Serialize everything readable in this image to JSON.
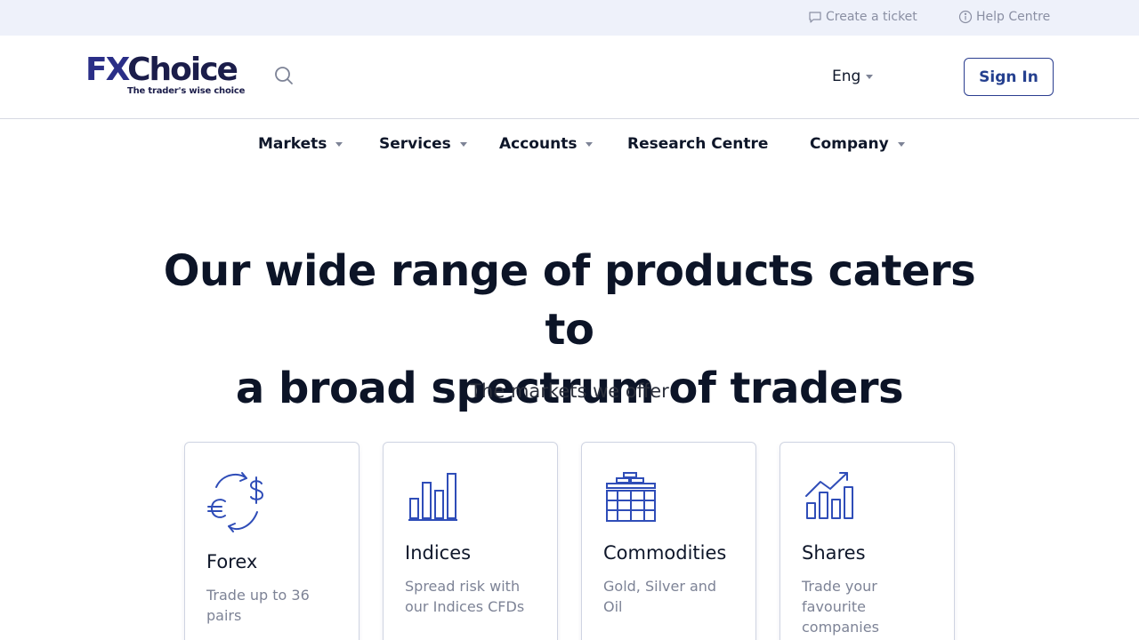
{
  "topbar": {
    "create_ticket": "Create a ticket",
    "help_centre": "Help Centre"
  },
  "header": {
    "logo_fx": "FX",
    "logo_choice": "Choice",
    "logo_tagline": "The trader's wise choice",
    "language": "Eng",
    "sign_in": "Sign In"
  },
  "nav": {
    "items": [
      {
        "label": "Markets",
        "dropdown": true
      },
      {
        "label": "Services",
        "dropdown": true
      },
      {
        "label": "Accounts",
        "dropdown": true
      },
      {
        "label": "Research Centre",
        "dropdown": false
      },
      {
        "label": "Company",
        "dropdown": true
      }
    ]
  },
  "hero": {
    "title_line1": "Our wide range of products caters to",
    "title_line2": "a broad spectrum of traders",
    "subtitle": "The markets we offer"
  },
  "cards": [
    {
      "title": "Forex",
      "desc": "Trade up to 36 pairs",
      "icon": "currency-exchange-icon"
    },
    {
      "title": "Indices",
      "desc": "Spread risk with our Indices CFDs",
      "icon": "bar-chart-icon"
    },
    {
      "title": "Commodities",
      "desc": "Gold, Silver and Oil",
      "icon": "gold-bars-icon"
    },
    {
      "title": "Shares",
      "desc": "Trade your favourite companies",
      "icon": "rising-chart-icon"
    }
  ],
  "colors": {
    "brand_blue": "#2a2e87",
    "icon_blue": "#2f4db8",
    "topbar_bg": "#eef1fa",
    "muted_text": "#7d8396"
  }
}
